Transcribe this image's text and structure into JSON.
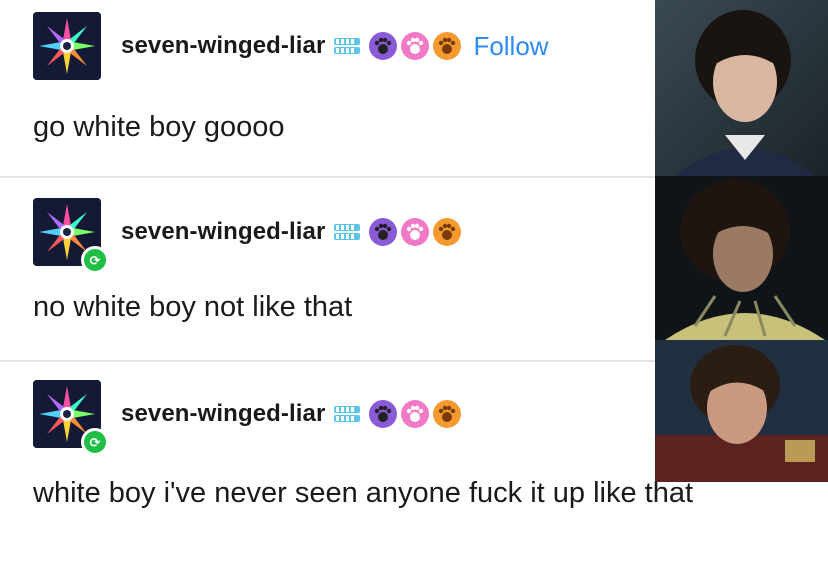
{
  "posts": [
    {
      "username": "seven-winged-liar",
      "follow_label": "Follow",
      "text": "go white boy goooo",
      "reblogged": false
    },
    {
      "username": "seven-winged-liar",
      "text": "no white boy not like that",
      "reblogged": true
    },
    {
      "username": "seven-winged-liar",
      "text": "white boy i've never seen anyone fuck it up like that",
      "reblogged": true
    }
  ],
  "badges": [
    "teeth-icon",
    "paw-icon-dark",
    "paw-icon-pink",
    "paw-icon-orange"
  ],
  "colors": {
    "follow": "#2f8cf5",
    "reblog_badge": "#1fbf46",
    "divider": "#e4e4e4",
    "text": "#1a1a1a"
  },
  "photos": [
    {
      "description_icon": "portrait-photo-1"
    },
    {
      "description_icon": "portrait-photo-2"
    },
    {
      "description_icon": "portrait-photo-3"
    }
  ]
}
